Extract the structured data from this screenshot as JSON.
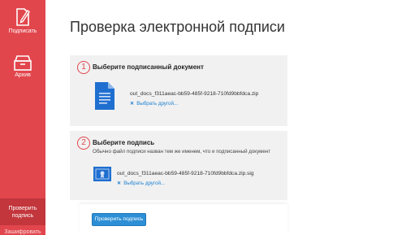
{
  "sidebar": {
    "items": [
      {
        "label": "Подписать",
        "icon": "sign-icon"
      },
      {
        "label": "Архив",
        "icon": "archive-icon"
      },
      {
        "label": "Проверить подпись",
        "icon": ""
      },
      {
        "label": "Зашифровать",
        "icon": ""
      }
    ]
  },
  "main": {
    "title": "Проверка электронной подписи",
    "step1": {
      "number": "1",
      "title": "Выберите подписанный документ",
      "file_name": "out_docs_f311aeac-bb59-485f-9218-710fd9bbfdca.zip",
      "change_label": "Выбрать другой..."
    },
    "step2": {
      "number": "2",
      "title": "Выберите подпись",
      "hint": "Обычно файл подписи назван тем же именем, что и подписанный документ",
      "file_name": "out_docs_f311aeac-bb59-485f-9218-710fd9bbfdca.zip.sig",
      "change_label": "Выбрать другой..."
    },
    "verify_button": "Проверить подпись"
  },
  "colors": {
    "accent": "#e2464d",
    "accent_dark": "#c2363c",
    "button": "#2d8fd5",
    "doc_icon": "#1f6fd0",
    "link": "#1a7fd0"
  }
}
